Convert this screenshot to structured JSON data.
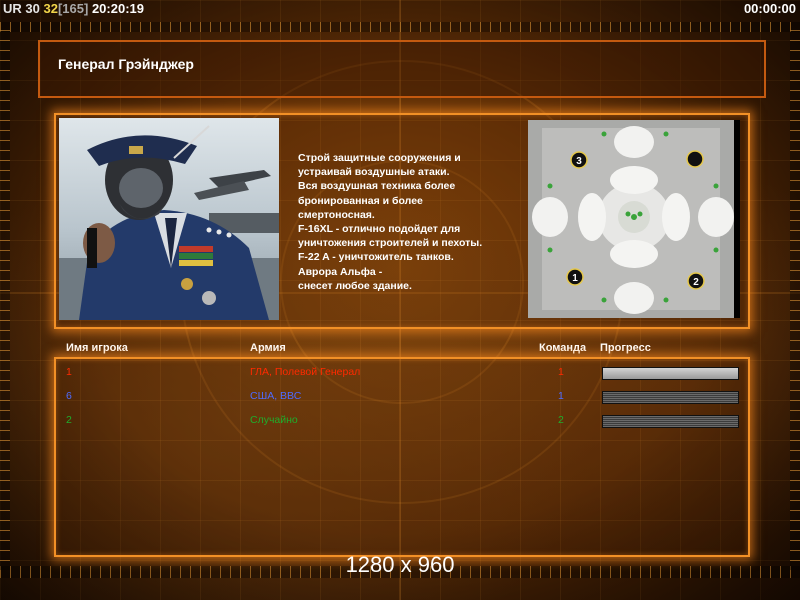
{
  "hud": {
    "tag": "UR",
    "num1": "30",
    "num2": "32",
    "bracket": "[165]",
    "clock": "20:20:19",
    "timer": "00:00:00"
  },
  "general": {
    "name": "Генерал Грэйнджер",
    "description_lines": [
      "Строй защитные сооружения и",
      " устраивай воздушные атаки.",
      "Вся воздушная техника более",
      " бронированная и более",
      "смертоносная.",
      "F-16XL - отлично подойдет для",
      " уничтожения строителей и пехоты.",
      "F-22 A - уничтожитель танков.",
      "Аврора Альфа -",
      "снесет любое здание."
    ]
  },
  "minimap": {
    "start_positions": [
      "3",
      "1",
      "2"
    ]
  },
  "roster": {
    "headers": {
      "player": "Имя игрока",
      "army": "Армия",
      "team": "Команда",
      "progress": "Прогресс"
    },
    "rows": [
      {
        "player": "1",
        "army": "ГЛА, Полевой Генерал",
        "team": "1",
        "color": "#ff2a00",
        "progress": 1.0
      },
      {
        "player": "6",
        "army": "США, ВВС",
        "team": "1",
        "color": "#4d6bff",
        "progress": 0.0
      },
      {
        "player": "2",
        "army": "Случайно",
        "team": "2",
        "color": "#1fae2c",
        "progress": 0.0
      }
    ]
  },
  "footer": {
    "resolution": "1280 x 960"
  },
  "colors": {
    "frame": "#f29026",
    "title_frame": "#c45a10"
  }
}
